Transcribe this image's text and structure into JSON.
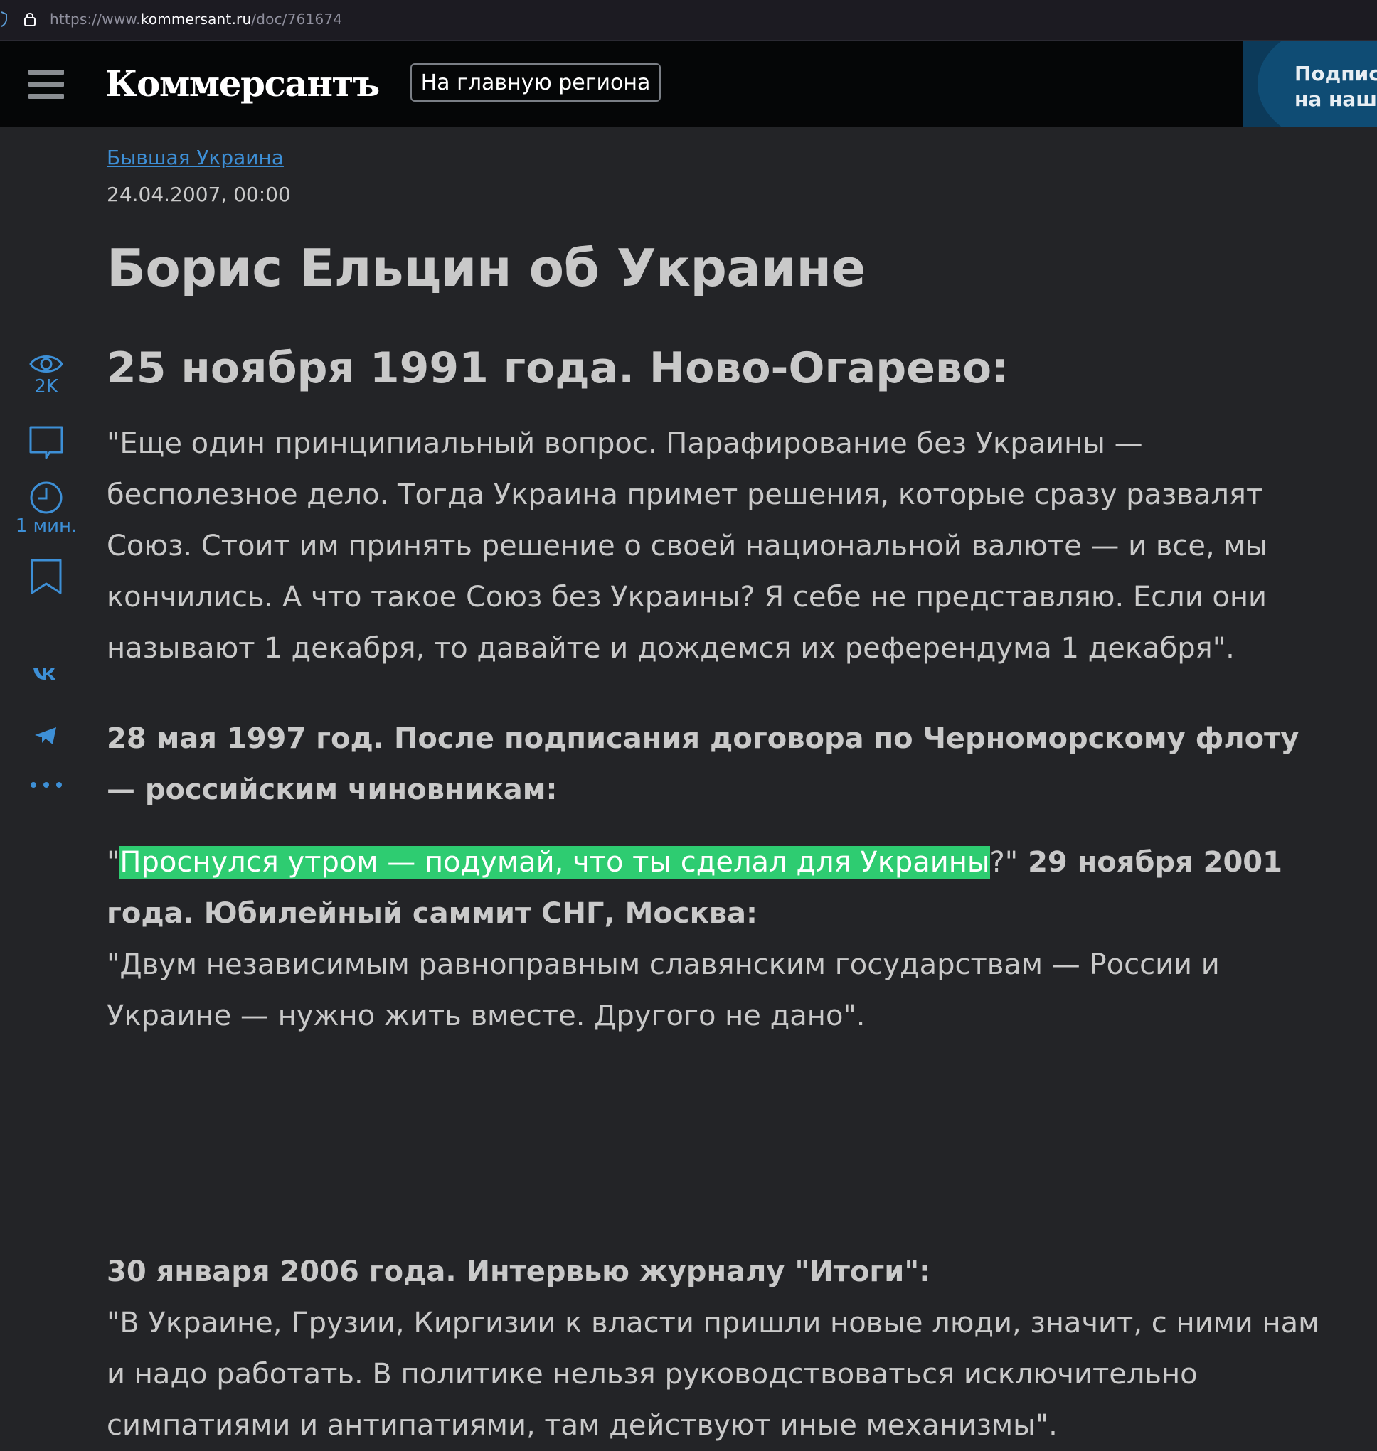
{
  "browser": {
    "url_prefix": "https://www.",
    "url_host": "kommersant.ru",
    "url_path": "/doc/761674"
  },
  "header": {
    "logo": "Коммерсантъ",
    "region_button": "На главную региона",
    "subscribe_line1": "Подпис",
    "subscribe_line2": "на наш"
  },
  "sidebar": {
    "views": "2K",
    "read_time": "1 мин."
  },
  "article": {
    "rubric": "Бывшая Украина",
    "date": "24.04.2007, 00:00",
    "title": "Борис Ельцин об Украине",
    "subtitle": "25 ноября 1991 года. Ново-Огарево:",
    "p1": "\"Еще один принципиальный вопрос. Парафирование без Украины — бесполезное дело. Тогда Украина примет решения, которые сразу развалят Союз. Стоит им принять решение о своей национальной валюте — и все, мы кончились. А что такое Союз без Украины? Я себе не представляю. Если они называют 1 декабря, то давайте и дождемся их референдума 1 декабря\".",
    "h2": "28 мая 1997 год. После подписания договора по Черноморскому флоту — российским чиновникам:",
    "q1_open": "\"",
    "q1_highlight": "Проснулся утром — подумай, что ты сделал для Украины",
    "q1_close": "?\"",
    "h3": " 29 ноября 2001 года. Юбилейный саммит СНГ, Москва:",
    "p3": "\"Двум независимым равноправным славянским государствам — России и Украине — нужно жить вместе. Другого не дано\".",
    "h4": "30 января 2006 года. Интервью журналу \"Итоги\":",
    "p4": "\"В Украине, Грузии, Киргизии к власти пришли новые люди, значит, с ними нам и надо работать. В политике нельзя руководствоваться исключительно симпатиями и антипатиями, там действуют иные механизмы\"."
  },
  "colors": {
    "background": "#232427",
    "header": "#050607",
    "link": "#3d8fd6",
    "highlight": "#2ecc71"
  }
}
